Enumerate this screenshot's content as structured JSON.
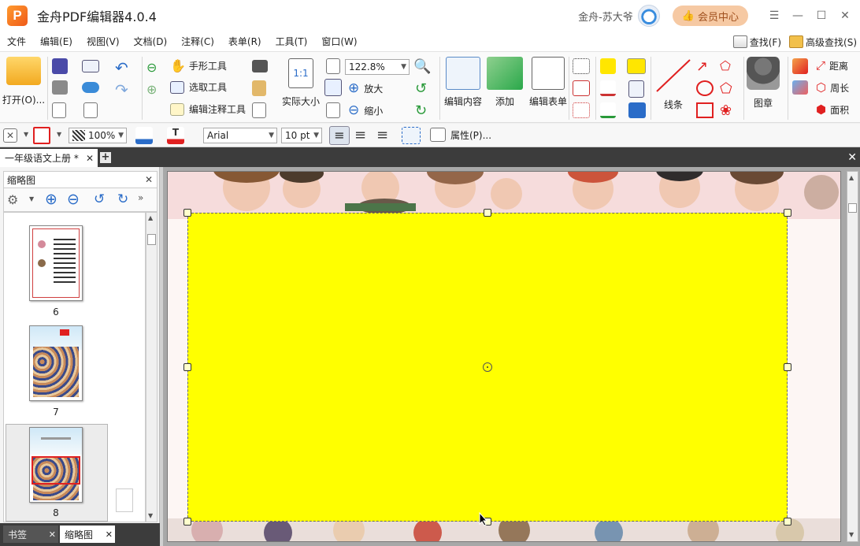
{
  "app": {
    "logo_letter": "P",
    "title": "金舟PDF编辑器4.0.4",
    "user_name": "金舟-苏大爷",
    "vip_label": "会员中心"
  },
  "menu": {
    "items": [
      "文件",
      "编辑(E)",
      "视图(V)",
      "文档(D)",
      "注释(C)",
      "表单(R)",
      "工具(T)",
      "窗口(W)"
    ],
    "find_label": "查找(F)",
    "advanced_find_label": "高级查找(S)"
  },
  "ribbon": {
    "open_label": "打开(O)...",
    "hand_tool": "手形工具",
    "select_tool": "选取工具",
    "edit_annot_tool": "编辑注释工具",
    "actual_size": "实际大小",
    "zoom_value": "122.8%",
    "zoom_in": "放大",
    "zoom_out": "缩小",
    "edit_content": "编辑内容",
    "add": "添加",
    "edit_form": "编辑表单",
    "line_tool": "线条",
    "stamp": "图章",
    "distance": "距离",
    "perimeter": "周长",
    "area": "面积",
    "actual_size_icon_text": "1:1"
  },
  "format_bar": {
    "opacity": "100%",
    "font_name": "Arial",
    "font_size": "10 pt",
    "properties": "属性(P)..."
  },
  "tabs": {
    "doc_tab": "一年级语文上册 *"
  },
  "left_panel": {
    "title": "缩略图",
    "thumbnails": [
      {
        "label": "6"
      },
      {
        "label": "7"
      },
      {
        "label": "8"
      }
    ],
    "bottom_tabs": [
      "书签",
      "缩略图"
    ]
  },
  "colors": {
    "highlight": "#ffff00",
    "tab_bg": "#3c3c3c",
    "vip_bg": "#f6c9a3"
  }
}
